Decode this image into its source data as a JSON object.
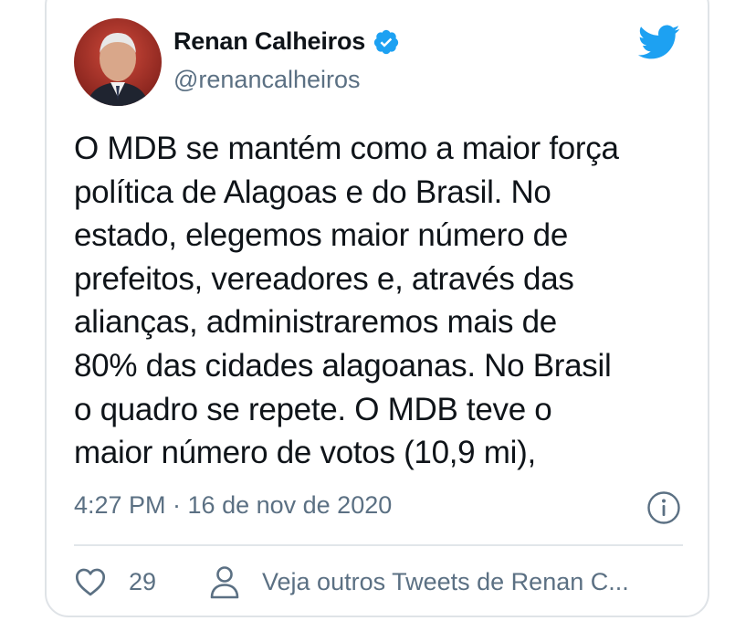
{
  "tweet": {
    "author_name": "Renan Calheiros",
    "handle": "@renancalheiros",
    "text": "O MDB se mantém como a maior força\npolítica de Alagoas e do Brasil. No\nestado, elegemos maior número de\nprefeitos, vereadores e, através das\nalianças, administraremos mais de\n80% das cidades alagoanas. No Brasil\no quadro se repete. O MDB teve o\nmaior número de votos (10,9 mi),",
    "timestamp": "4:27 PM · 16 de nov de 2020",
    "like_count": "29",
    "more_tweets_link": "Veja outros Tweets de Renan C..."
  },
  "icons": {
    "verified": "verified-badge-icon",
    "brand": "twitter-bird-icon",
    "info": "info-icon",
    "like": "heart-icon",
    "profile": "person-icon"
  },
  "colors": {
    "brand_blue": "#1da1f2",
    "text_primary": "#0f1419",
    "text_secondary": "#5b7083",
    "border": "#dfe3e7"
  }
}
